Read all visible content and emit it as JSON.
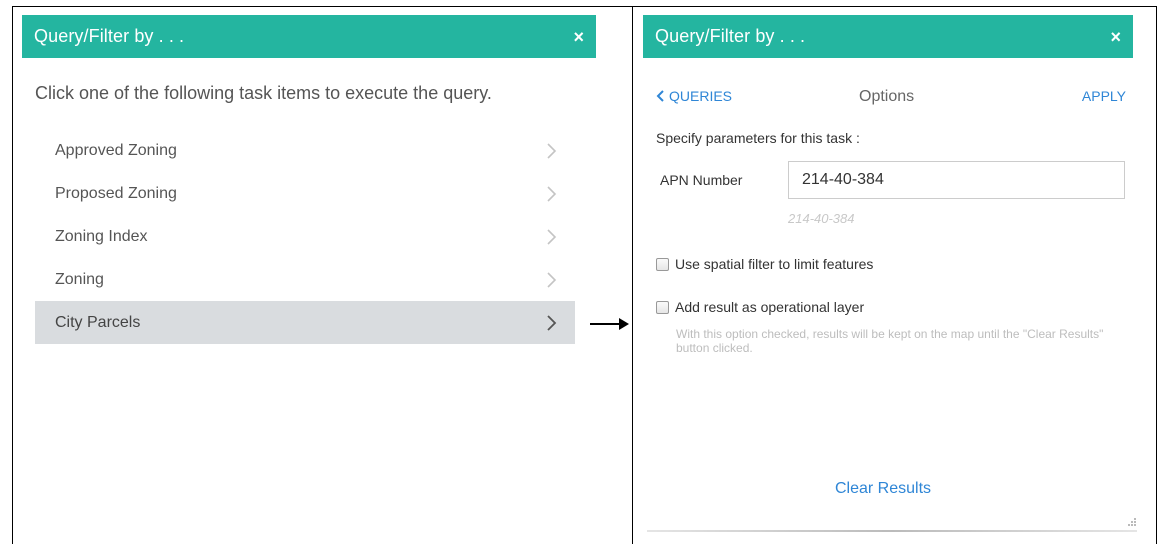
{
  "left_panel": {
    "title": "Query/Filter by . . .",
    "close_label": "×",
    "instruction": "Click one of the following task items to execute the query.",
    "tasks": [
      {
        "label": "Approved Zoning"
      },
      {
        "label": "Proposed Zoning"
      },
      {
        "label": "Zoning Index"
      },
      {
        "label": "Zoning"
      },
      {
        "label": "City Parcels",
        "selected": true
      }
    ]
  },
  "right_panel": {
    "title": "Query/Filter by . . .",
    "close_label": "×",
    "nav": {
      "back_label": "QUERIES",
      "title": "Options",
      "apply_label": "APPLY"
    },
    "spec_label": "Specify parameters for this task :",
    "param": {
      "label": "APN Number",
      "value": "214-40-384",
      "hint": "214-40-384"
    },
    "spatial_filter_label": "Use spatial filter to limit features",
    "operational_layer_label": "Add result as operational layer",
    "operational_layer_help": "With this option checked, results will be kept on the map until the \"Clear Results\" button clicked.",
    "clear_results_label": "Clear Results"
  },
  "colors": {
    "header_bg": "#24b5a0",
    "link": "#2f86d6",
    "selected_row": "#d9dcdf"
  },
  "icons": [
    "close-icon",
    "chevron-right-icon",
    "chevron-left-icon",
    "arrow-right-icon",
    "resize-grip-icon"
  ]
}
